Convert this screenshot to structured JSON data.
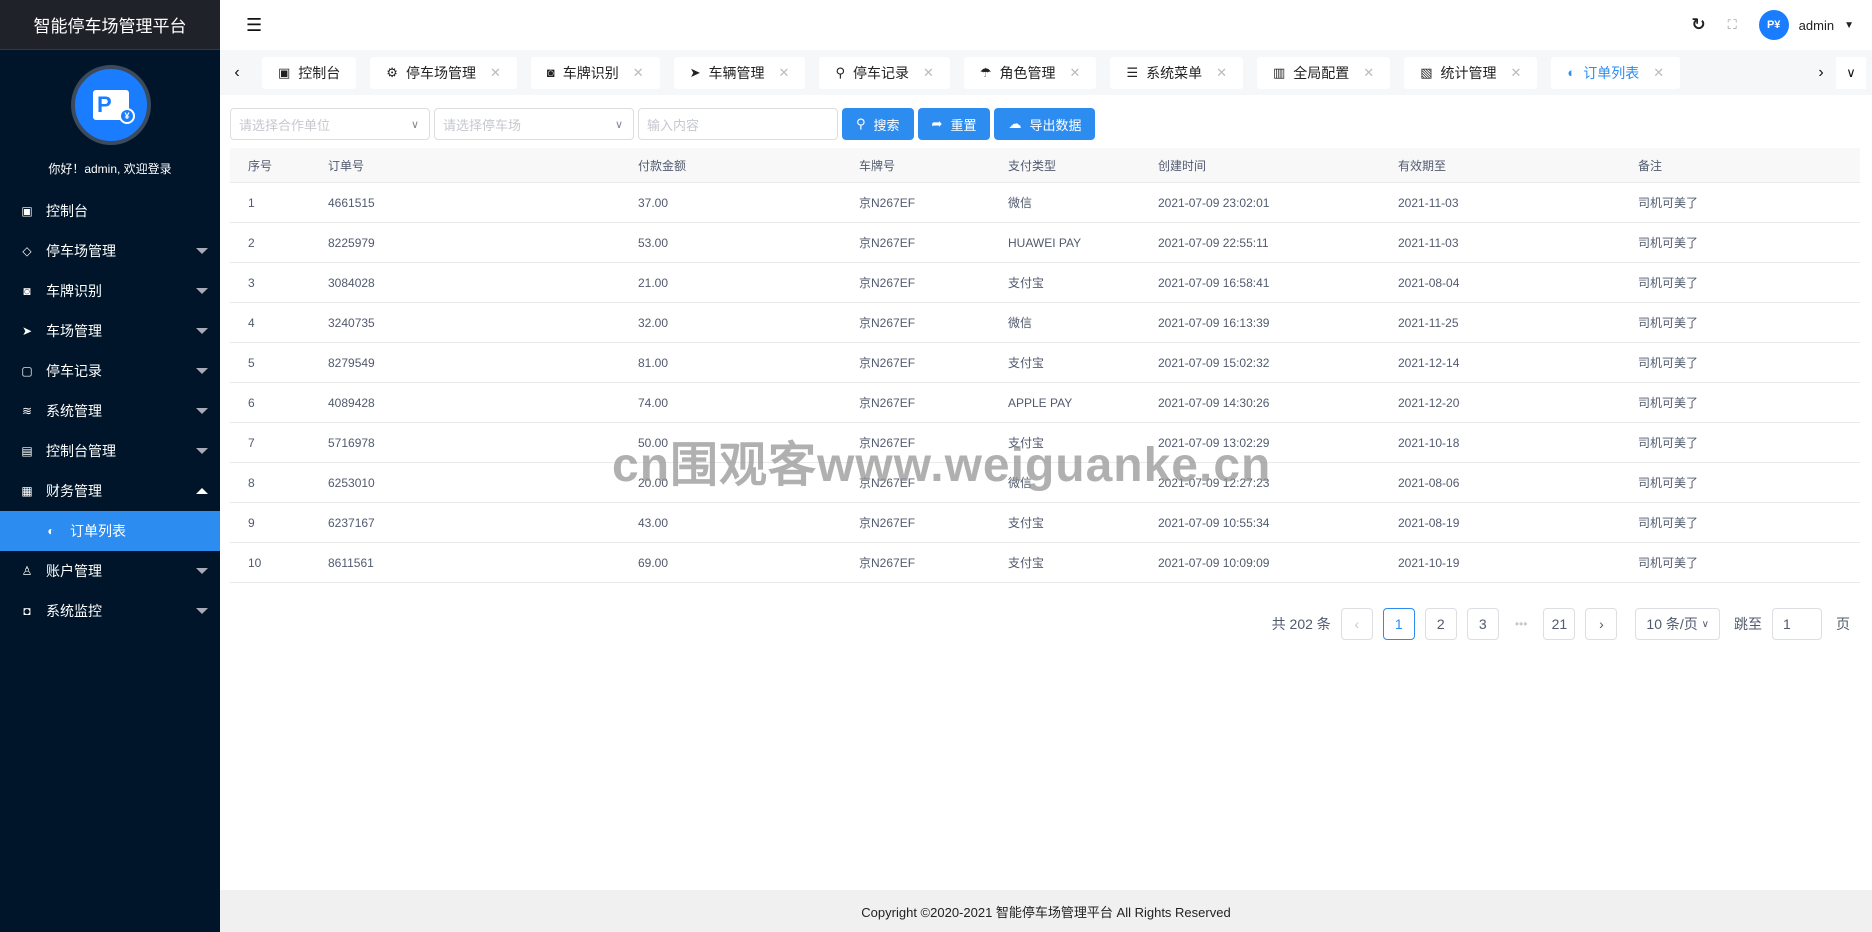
{
  "app": {
    "title": "智能停车场管理平台",
    "welcome": "你好！admin, 欢迎登录",
    "user": "admin",
    "avatar_text": "P¥"
  },
  "sidebar": {
    "items": [
      {
        "label": "控制台",
        "icon": "monitor-icon",
        "glyph": "▣",
        "arrow": ""
      },
      {
        "label": "停车场管理",
        "icon": "diamond-icon",
        "glyph": "◇",
        "arrow": "down"
      },
      {
        "label": "车牌识别",
        "icon": "camera-icon",
        "glyph": "◙",
        "arrow": "down"
      },
      {
        "label": "车场管理",
        "icon": "paper-plane-icon",
        "glyph": "➤",
        "arrow": "down"
      },
      {
        "label": "停车记录",
        "icon": "note-icon",
        "glyph": "▢",
        "arrow": "down"
      },
      {
        "label": "系统管理",
        "icon": "layers-icon",
        "glyph": "≋",
        "arrow": "down"
      },
      {
        "label": "控制台管理",
        "icon": "clipboard-icon",
        "glyph": "▤",
        "arrow": "down"
      },
      {
        "label": "财务管理",
        "icon": "apps-icon",
        "glyph": "▦",
        "arrow": "up"
      },
      {
        "label": "订单列表",
        "icon": "palette-icon",
        "glyph": "◐",
        "arrow": "",
        "active": true
      },
      {
        "label": "账户管理",
        "icon": "user-icon",
        "glyph": "♙",
        "arrow": "down"
      },
      {
        "label": "系统监控",
        "icon": "camera-icon",
        "glyph": "◘",
        "arrow": "down"
      }
    ]
  },
  "tabs": [
    {
      "label": "控制台",
      "glyph": "▣",
      "icon": "monitor-icon",
      "closable": false
    },
    {
      "label": "停车场管理",
      "glyph": "⚙",
      "icon": "gear-icon",
      "closable": true
    },
    {
      "label": "车牌识别",
      "glyph": "◙",
      "icon": "camera-icon",
      "closable": true
    },
    {
      "label": "车辆管理",
      "glyph": "➤",
      "icon": "paper-plane-icon",
      "closable": true
    },
    {
      "label": "停车记录",
      "glyph": "⚲",
      "icon": "location-icon",
      "closable": true
    },
    {
      "label": "角色管理",
      "glyph": "☂",
      "icon": "palm-icon",
      "closable": true
    },
    {
      "label": "系统菜单",
      "glyph": "☰",
      "icon": "menu-icon",
      "closable": true
    },
    {
      "label": "全局配置",
      "glyph": "▥",
      "icon": "config-icon",
      "closable": true
    },
    {
      "label": "统计管理",
      "glyph": "▧",
      "icon": "stats-icon",
      "closable": true
    },
    {
      "label": "订单列表",
      "glyph": "◐",
      "icon": "palette-icon",
      "closable": true,
      "active": true
    }
  ],
  "filters": {
    "partner_placeholder": "请选择合作单位",
    "lot_placeholder": "请选择停车场",
    "keyword_placeholder": "输入内容",
    "search": "搜索",
    "reset": "重置",
    "export": "导出数据"
  },
  "table": {
    "headers": [
      "序号",
      "订单号",
      "付款金额",
      "车牌号",
      "支付类型",
      "创建时间",
      "有效期至",
      "备注"
    ],
    "rows": [
      [
        "1",
        "4661515",
        "37.00",
        "京N267EF",
        "微信",
        "2021-07-09 23:02:01",
        "2021-11-03",
        "司机可美了"
      ],
      [
        "2",
        "8225979",
        "53.00",
        "京N267EF",
        "HUAWEI PAY",
        "2021-07-09 22:55:11",
        "2021-11-03",
        "司机可美了"
      ],
      [
        "3",
        "3084028",
        "21.00",
        "京N267EF",
        "支付宝",
        "2021-07-09 16:58:41",
        "2021-08-04",
        "司机可美了"
      ],
      [
        "4",
        "3240735",
        "32.00",
        "京N267EF",
        "微信",
        "2021-07-09 16:13:39",
        "2021-11-25",
        "司机可美了"
      ],
      [
        "5",
        "8279549",
        "81.00",
        "京N267EF",
        "支付宝",
        "2021-07-09 15:02:32",
        "2021-12-14",
        "司机可美了"
      ],
      [
        "6",
        "4089428",
        "74.00",
        "京N267EF",
        "APPLE PAY",
        "2021-07-09 14:30:26",
        "2021-12-20",
        "司机可美了"
      ],
      [
        "7",
        "5716978",
        "50.00",
        "京N267EF",
        "支付宝",
        "2021-07-09 13:02:29",
        "2021-10-18",
        "司机可美了"
      ],
      [
        "8",
        "6253010",
        "20.00",
        "京N267EF",
        "微信",
        "2021-07-09 12:27:23",
        "2021-08-06",
        "司机可美了"
      ],
      [
        "9",
        "6237167",
        "43.00",
        "京N267EF",
        "支付宝",
        "2021-07-09 10:55:34",
        "2021-08-19",
        "司机可美了"
      ],
      [
        "10",
        "8611561",
        "69.00",
        "京N267EF",
        "支付宝",
        "2021-07-09 10:09:09",
        "2021-10-19",
        "司机可美了"
      ]
    ]
  },
  "pagination": {
    "total": "共 202 条",
    "pages": [
      "1",
      "2",
      "3"
    ],
    "ellipsis": "•••",
    "last": "21",
    "current": "1",
    "page_size": "10 条/页",
    "jump_label": "跳至",
    "jump_value": "1",
    "page_suffix": "页"
  },
  "footer": "Copyright ©2020-2021 智能停车场管理平台 All Rights Reserved",
  "watermark": "cn围观客www.weiguanke.cn",
  "colors": {
    "accent": "#2d8cf0",
    "sidebar": "#001529"
  }
}
